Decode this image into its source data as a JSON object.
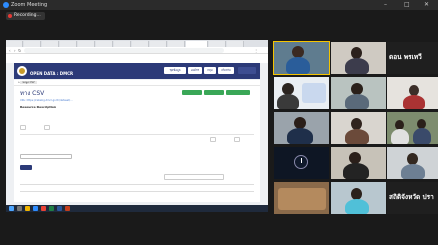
{
  "zoom": {
    "title": "Zoom Meeting",
    "recording_label": "Recording...",
    "colors": {
      "accent": "#2d8cff",
      "rec": "#e53935"
    }
  },
  "browser": {
    "tabs": [
      "",
      "",
      "",
      "",
      "",
      "",
      "",
      "",
      "",
      "",
      "",
      "",
      ""
    ],
    "url": "",
    "bookmarks": ""
  },
  "site": {
    "name": "",
    "subtitle": "OPEN DATA : DMCR",
    "header_buttons": [
      "ชุดข้อมูล",
      "องค์กร",
      "กลุ่ม",
      "เกี่ยวกับ"
    ],
    "colors": {
      "primary": "#2c3a78",
      "success": "#3aa757",
      "danger": "#d9534f"
    },
    "breadcrumbs": [
      "",
      "",
      "",
      "",
      "ขอมูล CSV"
    ]
  },
  "resource": {
    "title": "ทาง CSV",
    "buttons": [
      "",
      "",
      ""
    ],
    "url_text": "URL: https://catalog.dmcr.go.th/dataset/…",
    "section_title": "Resource Description",
    "description": "",
    "extra": "",
    "pills": [
      "",
      ""
    ],
    "right_buttons": [
      "",
      ""
    ],
    "label": "",
    "select_value": "",
    "table_button": "",
    "pager": [
      "",
      "",
      ""
    ],
    "search_placeholder": "",
    "table_header": ""
  },
  "taskbar": {
    "time": ""
  },
  "gallery": [
    {
      "name": "",
      "highlight": true
    },
    {
      "name": "",
      "highlight": false
    },
    {
      "name": "",
      "big_text": "ดอน พรเทวี"
    },
    {
      "name": "",
      "highlight": false
    },
    {
      "name": "",
      "highlight": false
    },
    {
      "name": "",
      "highlight": false
    },
    {
      "name": "",
      "highlight": false
    },
    {
      "name": "",
      "highlight": false
    },
    {
      "name": "",
      "highlight": false
    },
    {
      "name": "",
      "highlight": false
    },
    {
      "name": "",
      "highlight": false
    },
    {
      "name": "",
      "highlight": false
    },
    {
      "name": "",
      "highlight": false
    },
    {
      "name": "",
      "highlight": false
    },
    {
      "name": "",
      "big_text": "สถิติจังหวัด ปรา"
    }
  ]
}
